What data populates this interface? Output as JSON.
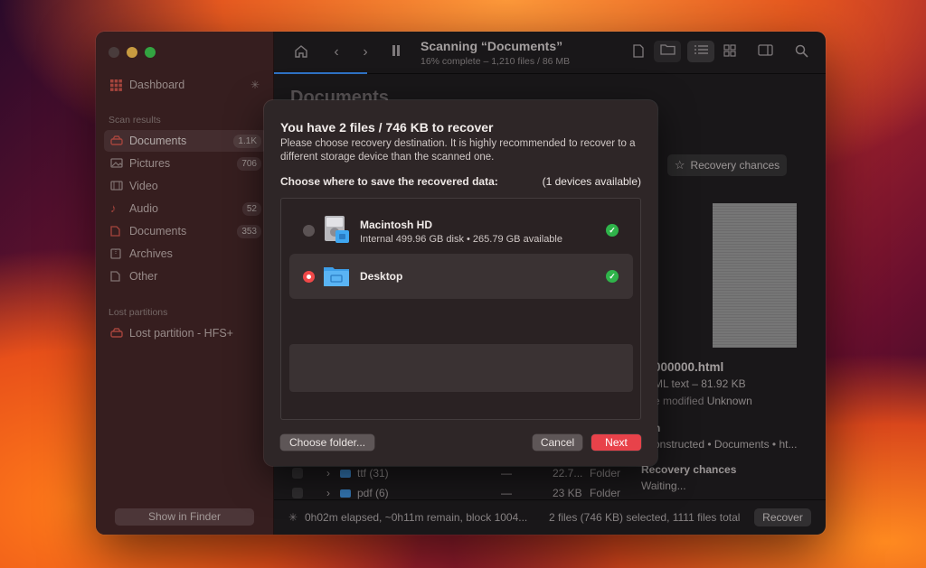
{
  "sidebar": {
    "dashboard": "Dashboard",
    "scan_results_heading": "Scan results",
    "items": [
      {
        "label": "Documents",
        "badge": "1.1K"
      },
      {
        "label": "Pictures",
        "badge": "706"
      },
      {
        "label": "Video",
        "badge": ""
      },
      {
        "label": "Audio",
        "badge": "52"
      },
      {
        "label": "Documents",
        "badge": "353"
      },
      {
        "label": "Archives",
        "badge": ""
      },
      {
        "label": "Other",
        "badge": ""
      }
    ],
    "lost_partitions_heading": "Lost partitions",
    "lost_partition": "Lost partition - HFS+",
    "show_in_finder": "Show in Finder"
  },
  "toolbar": {
    "scan_title": "Scanning “Documents”",
    "scan_subtitle": "16% complete – 1,210 files / 86 MB",
    "progress": 0.16
  },
  "main": {
    "page_title": "Documents",
    "recovery_chances_button": "Recovery chances",
    "files": [
      {
        "name": "ttf (31)",
        "size": "22.7...",
        "dash": "—",
        "kind": "Folder"
      },
      {
        "name": "pdf (6)",
        "size": "23 KB",
        "dash": "—",
        "kind": "Folder"
      }
    ]
  },
  "preview": {
    "filename": "000000.html",
    "kind_size": "ML text – 81.92 KB",
    "modified_label": "e modified",
    "modified_value": "Unknown",
    "path_label": "h",
    "path_value": "onstructed • Documents • ht...",
    "recovery_chances_label": "Recovery chances",
    "recovery_chances_value": "Waiting..."
  },
  "statusbar": {
    "elapsed": "0h02m elapsed, ~0h11m remain, block 1004...",
    "selection": "2 files (746 KB) selected, 1111 files total",
    "recover_button": "Recover"
  },
  "dialog": {
    "title": "You have 2 files / 746 KB to recover",
    "description": "Please choose recovery destination. It is highly recommended to recover to a different storage device than the scanned one.",
    "choose_label": "Choose where to save the recovered data:",
    "devices_available": "(1 devices available)",
    "destinations": [
      {
        "name": "Macintosh HD",
        "detail": "Internal 499.96 GB disk • 265.79 GB available",
        "selected": false
      },
      {
        "name": "Desktop",
        "detail": "",
        "selected": true
      }
    ],
    "choose_folder_button": "Choose folder...",
    "cancel_button": "Cancel",
    "next_button": "Next"
  }
}
